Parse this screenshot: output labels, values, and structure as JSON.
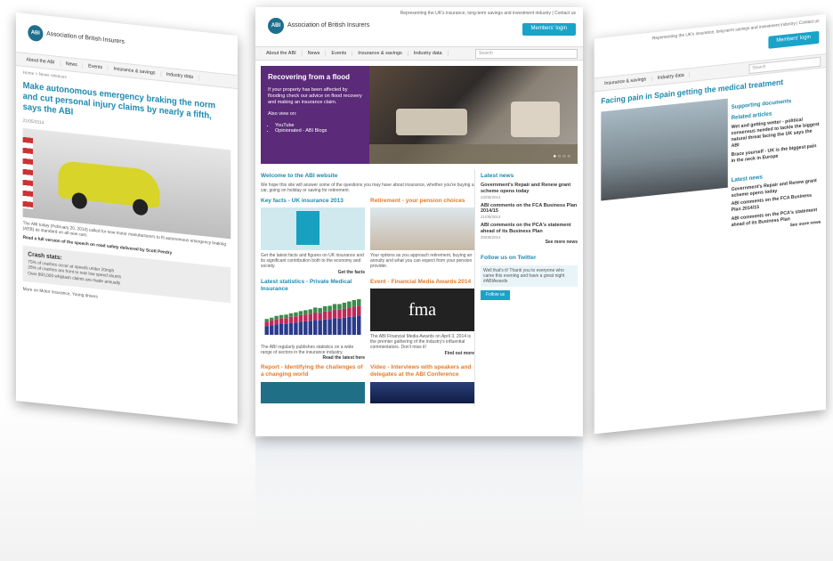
{
  "brand": {
    "logo_abbr": "ABI",
    "name": "Association of British Insurers",
    "tagline": "Representing the UK's insurance, long-term savings and investment industry | Contact us",
    "members_login": "Members' login"
  },
  "nav": {
    "items": [
      "About the ABI",
      "News",
      "Events",
      "Insurance & savings",
      "Industry data"
    ],
    "search_placeholder": "Search"
  },
  "left_page": {
    "breadcrumb": "Home > News releases",
    "headline": "Make autonomous emergency braking the norm and cut personal injury claims by nearly a fifth, says the ABI",
    "date": "21/05/2014",
    "body": "The ABI today (February 20, 2014) called for new motor manufacturers to fit autonomous emergency braking (AEB) as standard on all new cars.",
    "link_text": "Read a full version of the speech on road safety delivered by Scott Pendry",
    "crash_title": "Crash stats:",
    "crash_items": [
      "75% of crashes occur at speeds under 20mph",
      "26% of crashes are front to rear low speed shunts",
      "Over 800,000 whiplash claims are made annually"
    ],
    "footer": "More on Motor insurance, Young drivers"
  },
  "center_page": {
    "hero": {
      "title": "Recovering from a flood",
      "text": "If your property has been affected by flooding check our advice on flood recovery and making an insurance claim.",
      "also": "Also view on:",
      "links": [
        "YouTube",
        "Opinionated - ABI Blogs"
      ]
    },
    "welcome": {
      "title": "Welcome to the ABI website",
      "text": "We hope this site will answer some of the questions you may have about insurance, whether you're buying a car, going on holiday or saving for retirement."
    },
    "key_facts": {
      "title": "Key facts - UK insurance 2013",
      "text": "Get the latest facts and figures on UK insurance and its significant contribution both to the economy and society.",
      "more": "Get the facts"
    },
    "retirement": {
      "title": "Retirement - your pension choices",
      "text": "Your options as you approach retirement, buying an annuity and what you can expect from your pension provider."
    },
    "stats": {
      "title": "Latest statistics - Private Medical Insurance",
      "text": "The ABI regularly publishes statistics on a wide range of sectors in the insurance industry.",
      "more": "Read the latest here"
    },
    "event": {
      "title": "Event - Financial Media Awards 2014",
      "logo": "fma",
      "text": "The ABI Financial Media Awards on April 3, 2014 is the premier gathering of the industry's influential commentators. Don't miss it!",
      "more": "Find out more"
    },
    "report": {
      "title": "Report - Identifying the challenges of a changing world"
    },
    "video": {
      "title": "Video - Interviews with speakers and delegates at the ABI Conference"
    },
    "latest_news": {
      "title": "Latest news",
      "items": [
        {
          "title": "Government's Repair and Renew grant scheme opens today",
          "date": "22/05/2014"
        },
        {
          "title": "ABI comments on the FCA Business Plan 2014/15",
          "date": "21/05/2014"
        },
        {
          "title": "ABI comments on the PCA's statement ahead of its Business Plan",
          "date": "20/05/2014"
        }
      ],
      "see_more": "See more news"
    },
    "twitter": {
      "title": "Follow us on Twitter",
      "tweet": "Well that's it! Thank you to everyone who came this evening and have a great night #ABIAwards",
      "follow": "Follow us"
    }
  },
  "right_page": {
    "headline": "Facing pain in Spain getting the medical treatment",
    "supporting_title": "Supporting documents",
    "related_title": "Related articles",
    "related": [
      "Wet and getting wetter - political consensus needed to tackle the biggest natural threat facing the UK says the ABI",
      "Brace yourself - UK is the biggest pain in the neck in Europe"
    ],
    "latest_news_title": "Latest news",
    "see_more": "See more news"
  },
  "chart_data": {
    "type": "bar",
    "categories": [
      "1",
      "2",
      "3",
      "4",
      "5",
      "6",
      "7",
      "8",
      "9",
      "10",
      "11",
      "12",
      "13",
      "14",
      "15",
      "16",
      "17",
      "18",
      "19",
      "20"
    ],
    "series": [
      {
        "values": [
          20,
          22,
          24,
          26,
          25,
          27,
          28,
          30,
          31,
          32,
          34,
          33,
          35,
          36,
          38,
          37,
          39,
          41,
          42,
          44
        ]
      },
      {
        "values": [
          10,
          11,
          12,
          12,
          13,
          14,
          14,
          15,
          15,
          16,
          17,
          17,
          18,
          18,
          19,
          20,
          20,
          21,
          22,
          22
        ]
      },
      {
        "values": [
          6,
          6,
          7,
          7,
          8,
          8,
          9,
          9,
          10,
          10,
          11,
          11,
          12,
          12,
          13,
          13,
          14,
          14,
          15,
          15
        ]
      }
    ],
    "colors": [
      "#2a3a8c",
      "#c0285a",
      "#3a8c4a"
    ]
  }
}
